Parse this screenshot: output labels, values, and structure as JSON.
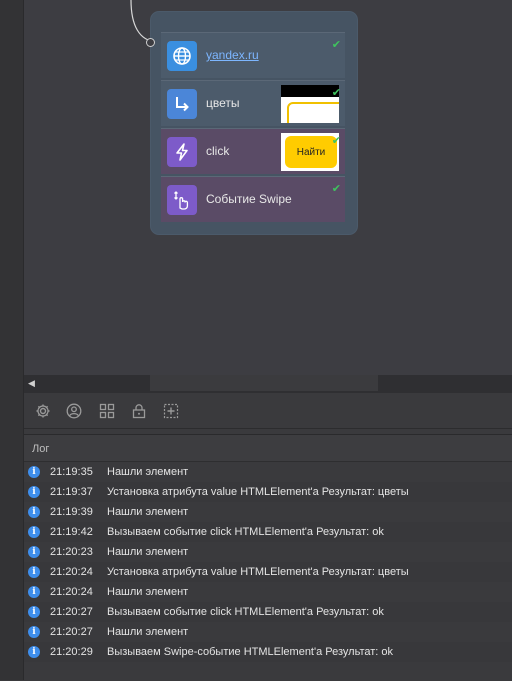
{
  "flow": {
    "steps": [
      {
        "label": "yandex.ru",
        "icon": "globe-icon",
        "status": "success"
      },
      {
        "label": "цветы",
        "icon": "set-value-arrow-icon",
        "status": "success",
        "thumbnail": "search-field-preview"
      },
      {
        "label": "click",
        "icon": "lightning-icon",
        "status": "success",
        "thumbnail_text": "Найти"
      },
      {
        "label": "Событие Swipe",
        "icon": "swipe-hand-icon",
        "status": "success"
      }
    ]
  },
  "toolbar": {
    "tools": [
      "settings-icon",
      "user-icon",
      "grid-icon",
      "lock-icon",
      "add-frame-icon"
    ]
  },
  "log": {
    "title": "Лог",
    "entries": [
      {
        "time": "21:19:35",
        "message": "Нашли элемент"
      },
      {
        "time": "21:19:37",
        "message": "Установка атрибута value HTMLElement'a  Результат: цветы"
      },
      {
        "time": "21:19:39",
        "message": "Нашли элемент"
      },
      {
        "time": "21:19:42",
        "message": "Вызываем событие click HTMLElement'a  Результат: ok"
      },
      {
        "time": "21:20:23",
        "message": "Нашли элемент"
      },
      {
        "time": "21:20:24",
        "message": "Установка атрибута value HTMLElement'a  Результат: цветы"
      },
      {
        "time": "21:20:24",
        "message": "Нашли элемент"
      },
      {
        "time": "21:20:27",
        "message": "Вызываем событие click HTMLElement'a  Результат: ok"
      },
      {
        "time": "21:20:27",
        "message": "Нашли элемент"
      },
      {
        "time": "21:20:29",
        "message": "Вызываем Swipe-событие  HTMLElement'a  Результат: ok"
      }
    ]
  },
  "colors": {
    "success": "#3fc35e",
    "info": "#3e8eec",
    "link": "#7db6ff",
    "thumb_button": "#ffcc00"
  }
}
